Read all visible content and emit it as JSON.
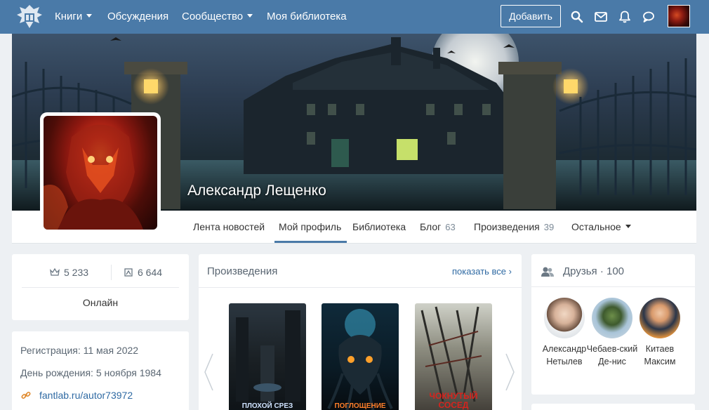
{
  "nav": {
    "items": [
      {
        "label": "Книги",
        "dropdown": true
      },
      {
        "label": "Обсуждения",
        "dropdown": false
      },
      {
        "label": "Сообщество",
        "dropdown": true
      },
      {
        "label": "Моя библиотека",
        "dropdown": false
      }
    ],
    "add_button": "Добавить",
    "icons": [
      "search-icon",
      "mail-icon",
      "bell-icon",
      "chat-icon"
    ]
  },
  "profile": {
    "name": "Александр Лещенко",
    "tabs": [
      {
        "label": "Лента новостей",
        "count": ""
      },
      {
        "label": "Мой профиль",
        "count": "",
        "active": true
      },
      {
        "label": "Библиотека",
        "count": ""
      },
      {
        "label": "Блог",
        "count": "63"
      },
      {
        "label": "Произведения",
        "count": "39"
      },
      {
        "label": "Остальное",
        "count": "",
        "dropdown": true
      }
    ]
  },
  "stats": {
    "rating": "5 233",
    "books": "6 644",
    "status": "Онлайн"
  },
  "info": {
    "registration": "Регистрация: 11 мая 2022",
    "birthday": "День рождения: 5 ноября 1984",
    "link": "fantlab.ru/autor73972"
  },
  "works": {
    "title": "Произведения",
    "show_all": "показать все",
    "books": [
      {
        "title": "ПЛОХОЙ СРЕЗ",
        "color": "#cfe3ff"
      },
      {
        "title": "ПОГЛОЩЕНИЕ",
        "color": "#ff7f2a"
      },
      {
        "title": "ЧОКНУТЫЙ СОСЕД",
        "color": "#d8231d"
      }
    ]
  },
  "friends": {
    "title": "Друзья",
    "count": "100",
    "list": [
      {
        "name": "Александр Нетылев"
      },
      {
        "name": "Чебаев-ский Де-нис"
      },
      {
        "name": "Китаев Максим"
      }
    ]
  },
  "colors": {
    "brand": "#4a7aa8",
    "link": "#2f6aa3",
    "background": "#edf0f3"
  }
}
